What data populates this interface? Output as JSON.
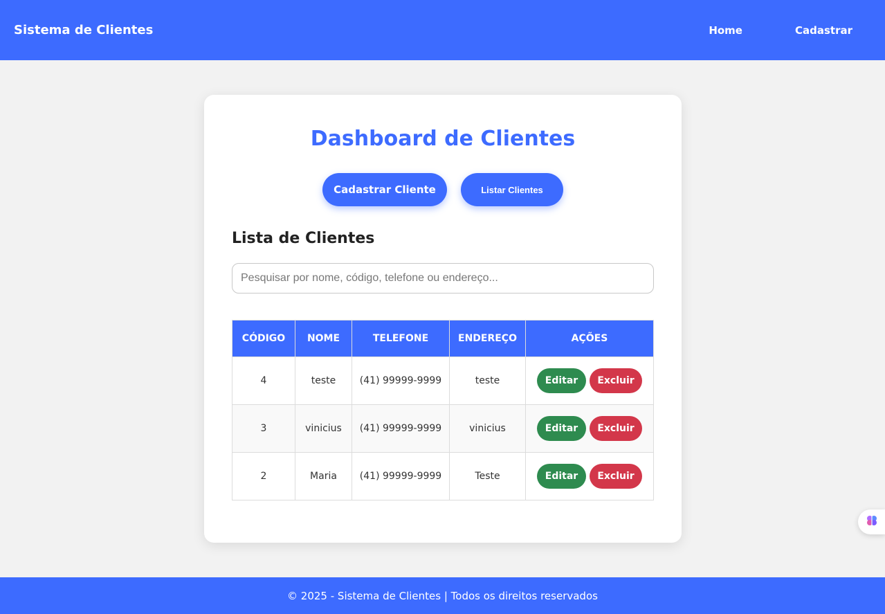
{
  "navbar": {
    "brand": "Sistema de Clientes",
    "links": [
      {
        "label": "Home"
      },
      {
        "label": "Cadastrar"
      }
    ]
  },
  "main": {
    "title": "Dashboard de Clientes",
    "buttons": {
      "cadastrar": "Cadastrar Cliente",
      "listar": "Listar Clientes"
    },
    "list_title": "Lista de Clientes",
    "search": {
      "placeholder": "Pesquisar por nome, código, telefone ou endereço...",
      "value": ""
    },
    "table": {
      "headers": [
        "CÓDIGO",
        "NOME",
        "TELEFONE",
        "ENDEREÇO",
        "AÇÕES"
      ],
      "rows": [
        {
          "codigo": "4",
          "nome": "teste",
          "telefone": "(41) 99999-9999",
          "endereco": "teste"
        },
        {
          "codigo": "3",
          "nome": "vinicius",
          "telefone": "(41) 99999-9999",
          "endereco": "vinicius"
        },
        {
          "codigo": "2",
          "nome": "Maria",
          "telefone": "(41) 99999-9999",
          "endereco": "Teste"
        }
      ],
      "actions": {
        "edit": "Editar",
        "delete": "Excluir"
      }
    }
  },
  "footer": {
    "text": "© 2025 - Sistema de Clientes | Todos os direitos reservados"
  },
  "colors": {
    "primary": "#3d6bff",
    "edit": "#2e8b4f",
    "delete": "#d3374a"
  },
  "floating": {
    "icon": "brain-icon"
  }
}
